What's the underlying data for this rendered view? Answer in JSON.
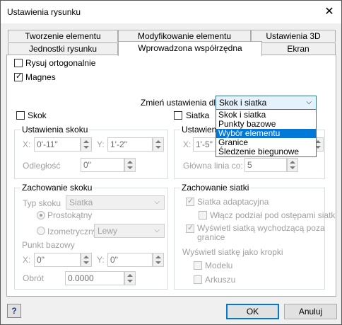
{
  "window": {
    "title": "Ustawienia rysunku",
    "close_glyph": "✕"
  },
  "tabs": {
    "row1": [
      "Tworzenie elementu",
      "Modyfikowanie elementu",
      "Ustawienia 3D"
    ],
    "row2": [
      "Jednostki rysunku",
      "Wprowadzona współrzędna",
      "Ekran"
    ],
    "active": "Wprowadzona współrzędna"
  },
  "options": {
    "ortho_label": "Rysuj ortogonalnie",
    "ortho_checked": false,
    "magnet_label": "Magnes",
    "magnet_checked": true
  },
  "settings_for": {
    "label": "Zmień ustawienia dla:",
    "value": "Skok i siatka",
    "dropdown_items": [
      "Skok i siatka",
      "Punkty bazowe",
      "Wybór elementu",
      "Granice",
      "Śledzenie biegunowe"
    ],
    "highlighted": "Wybór elementu"
  },
  "snap": {
    "checkbox_label": "Skok",
    "group_title": "Ustawienia skoku",
    "x_label": "X:",
    "x_value": "0'-11\"",
    "y_label": "Y:",
    "y_value": "1'-2\"",
    "distance_label": "Odległość",
    "distance_value": "0\""
  },
  "grid": {
    "checkbox_label": "Siatka",
    "group_title": "Ustawienia siatki",
    "x_label": "X:",
    "x_value": "1'-5\"",
    "major_label": "Główna linia co:",
    "major_value": "5"
  },
  "snap_behavior": {
    "group_title": "Zachowanie skoku",
    "type_label": "Typ skoku",
    "type_value": "Siatka",
    "rect_label": "Prostokątny",
    "iso_label": "Izometryczny",
    "iso_value": "Lewy",
    "base_label": "Punkt bazowy",
    "bx_label": "X:",
    "bx_value": "0\"",
    "by_label": "Y:",
    "by_value": "0\"",
    "rotation_label": "Obrót",
    "rotation_value": "0.0000"
  },
  "grid_behavior": {
    "group_title": "Zachowanie siatki",
    "adaptive_label": "Siatka adaptacyjna",
    "subdivide_label": "Włącz podział pod ostępami siatk",
    "beyond_label_1": "Wyświetl siatką wychodzącą poza",
    "beyond_label_2": "granice",
    "dots_label": "Wyświetl siatkę jako kropki",
    "model_label": "Modelu",
    "sheet_label": "Arkuszu"
  },
  "footer": {
    "help": "?",
    "ok": "OK",
    "cancel": "Anuluj"
  }
}
